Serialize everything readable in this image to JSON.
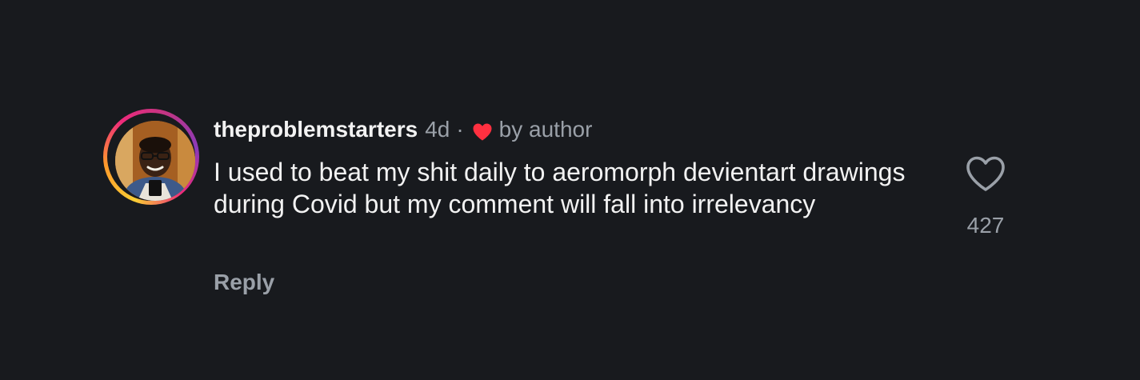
{
  "comment": {
    "username": "theproblemstarters",
    "time": "4d",
    "separator": "·",
    "liked_by_author_label": "by author",
    "text": "I used to beat my shit daily to aeromorph devientart drawings during Covid but my comment will fall into irrelevancy",
    "reply_label": "Reply",
    "like_count": "427",
    "icons": {
      "author_like": "heart-filled-icon",
      "like": "heart-outline-icon"
    },
    "colors": {
      "background": "#181a1e",
      "author_heart": "#ff3040",
      "story_ring": [
        "#f9ce34",
        "#ee2a7b",
        "#8a3ab9"
      ]
    }
  }
}
